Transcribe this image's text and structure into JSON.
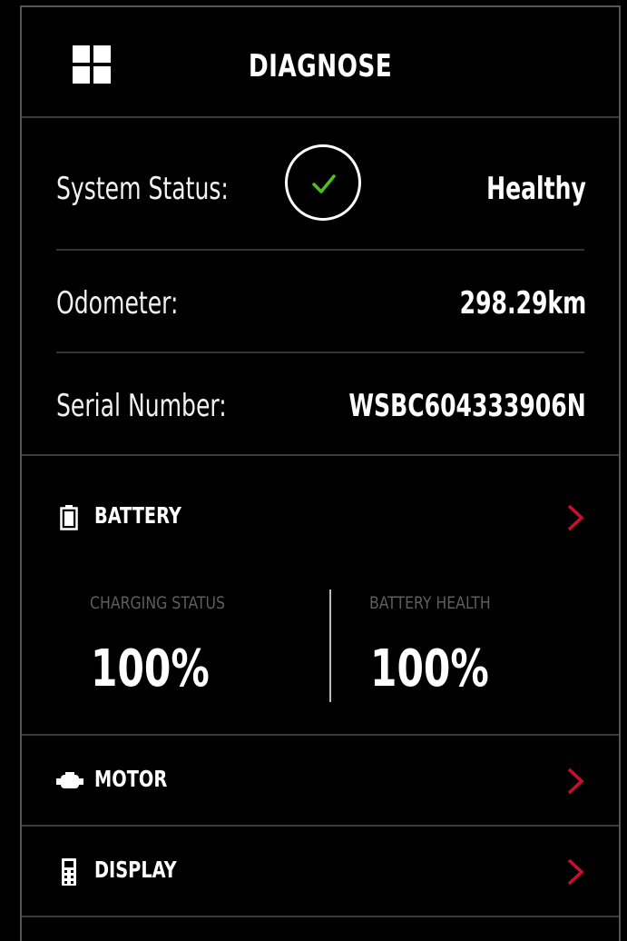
{
  "header": {
    "title": "DIAGNOSE",
    "menu_icon": "grid-menu-icon"
  },
  "info": {
    "system_status_label": "System Status:",
    "system_status_value": "Healthy",
    "status_icon": "check-circle-icon",
    "status_color": "#4cc21a",
    "odometer_label": "Odometer:",
    "odometer_value": "298.29km",
    "serial_label": "Serial Number:",
    "serial_value": "WSBC604333906N"
  },
  "battery": {
    "label": "BATTERY",
    "icon": "battery-icon",
    "charging_status_label": "CHARGING STATUS",
    "charging_status_value": "100%",
    "battery_health_label": "BATTERY HEALTH",
    "battery_health_value": "100%"
  },
  "motor": {
    "label": "MOTOR",
    "icon": "motor-icon"
  },
  "display": {
    "label": "DISPLAY",
    "icon": "display-icon"
  },
  "colors": {
    "background": "#000000",
    "chevron": "#c8102e",
    "muted_label": "#5e5e5e"
  }
}
